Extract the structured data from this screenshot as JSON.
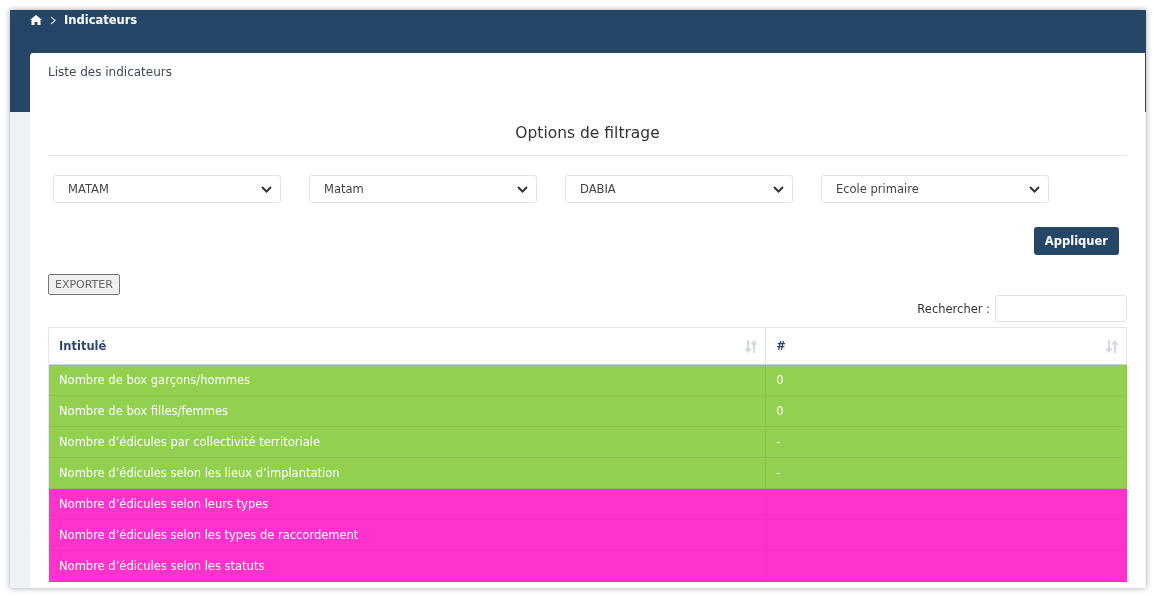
{
  "breadcrumb": {
    "current": "Indicateurs"
  },
  "card": {
    "title": "Liste des indicateurs"
  },
  "filters": {
    "title": "Options de filtrage",
    "dropdowns": [
      {
        "value": "MATAM"
      },
      {
        "value": "Matam"
      },
      {
        "value": "DABIA"
      },
      {
        "value": "Ecole primaire"
      }
    ],
    "apply_button": "Appliquer"
  },
  "export_button": "EXPORTER",
  "search": {
    "label": "Rechercher :"
  },
  "table": {
    "columns": [
      "Intitulé",
      "#"
    ],
    "rows": [
      {
        "cells": [
          "Nombre de box garçons/hommes",
          "0"
        ],
        "color": "#92d050"
      },
      {
        "cells": [
          "Nombre de box filles/femmes",
          "0"
        ],
        "color": "#92d050"
      },
      {
        "cells": [
          "Nombre d’édicules par collectivité territoriale",
          "-"
        ],
        "color": "#92d050"
      },
      {
        "cells": [
          "Nombre d’édicules selon les lieux d’implantation",
          "-"
        ],
        "color": "#92d050"
      },
      {
        "cells": [
          "Nombre d’édicules selon leurs types"
        ],
        "color": "#ff33cc"
      },
      {
        "cells": [
          "Nombre d’édicules selon les types de raccordement"
        ],
        "color": "#ff33cc"
      },
      {
        "cells": [
          "Nombre d’édicules selon les statuts"
        ],
        "color": "#ff33cc"
      }
    ]
  }
}
